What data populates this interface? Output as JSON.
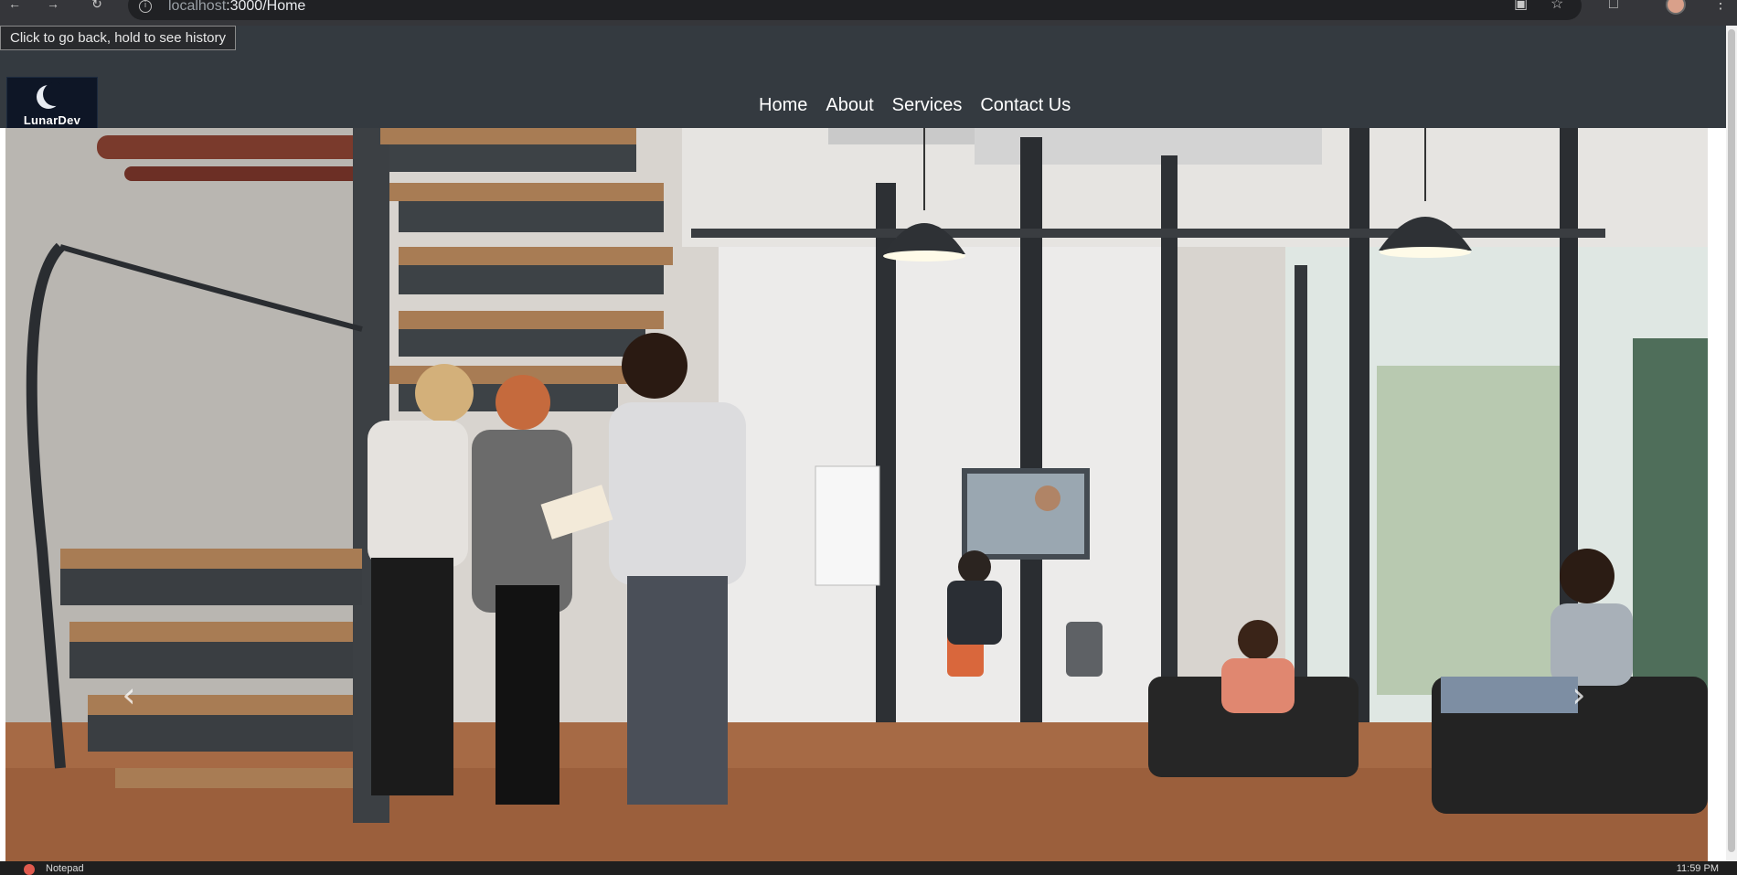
{
  "browser": {
    "url_host": "localhost",
    "url_path": ":3000/Home",
    "back_tooltip": "Click to go back, hold to see history"
  },
  "site": {
    "logo_text": "LunarDev",
    "nav": [
      {
        "label": "Home"
      },
      {
        "label": "About"
      },
      {
        "label": "Services"
      },
      {
        "label": "Contact Us"
      }
    ]
  },
  "carousel": {
    "prev_icon": "chevron-left",
    "next_icon": "chevron-right",
    "image_subject": "office-team-photo"
  },
  "colors": {
    "navbar": "#343a40",
    "logo_bg": "#0e1626"
  },
  "taskbar": {
    "label": "Notepad",
    "time": "11:59 PM"
  }
}
